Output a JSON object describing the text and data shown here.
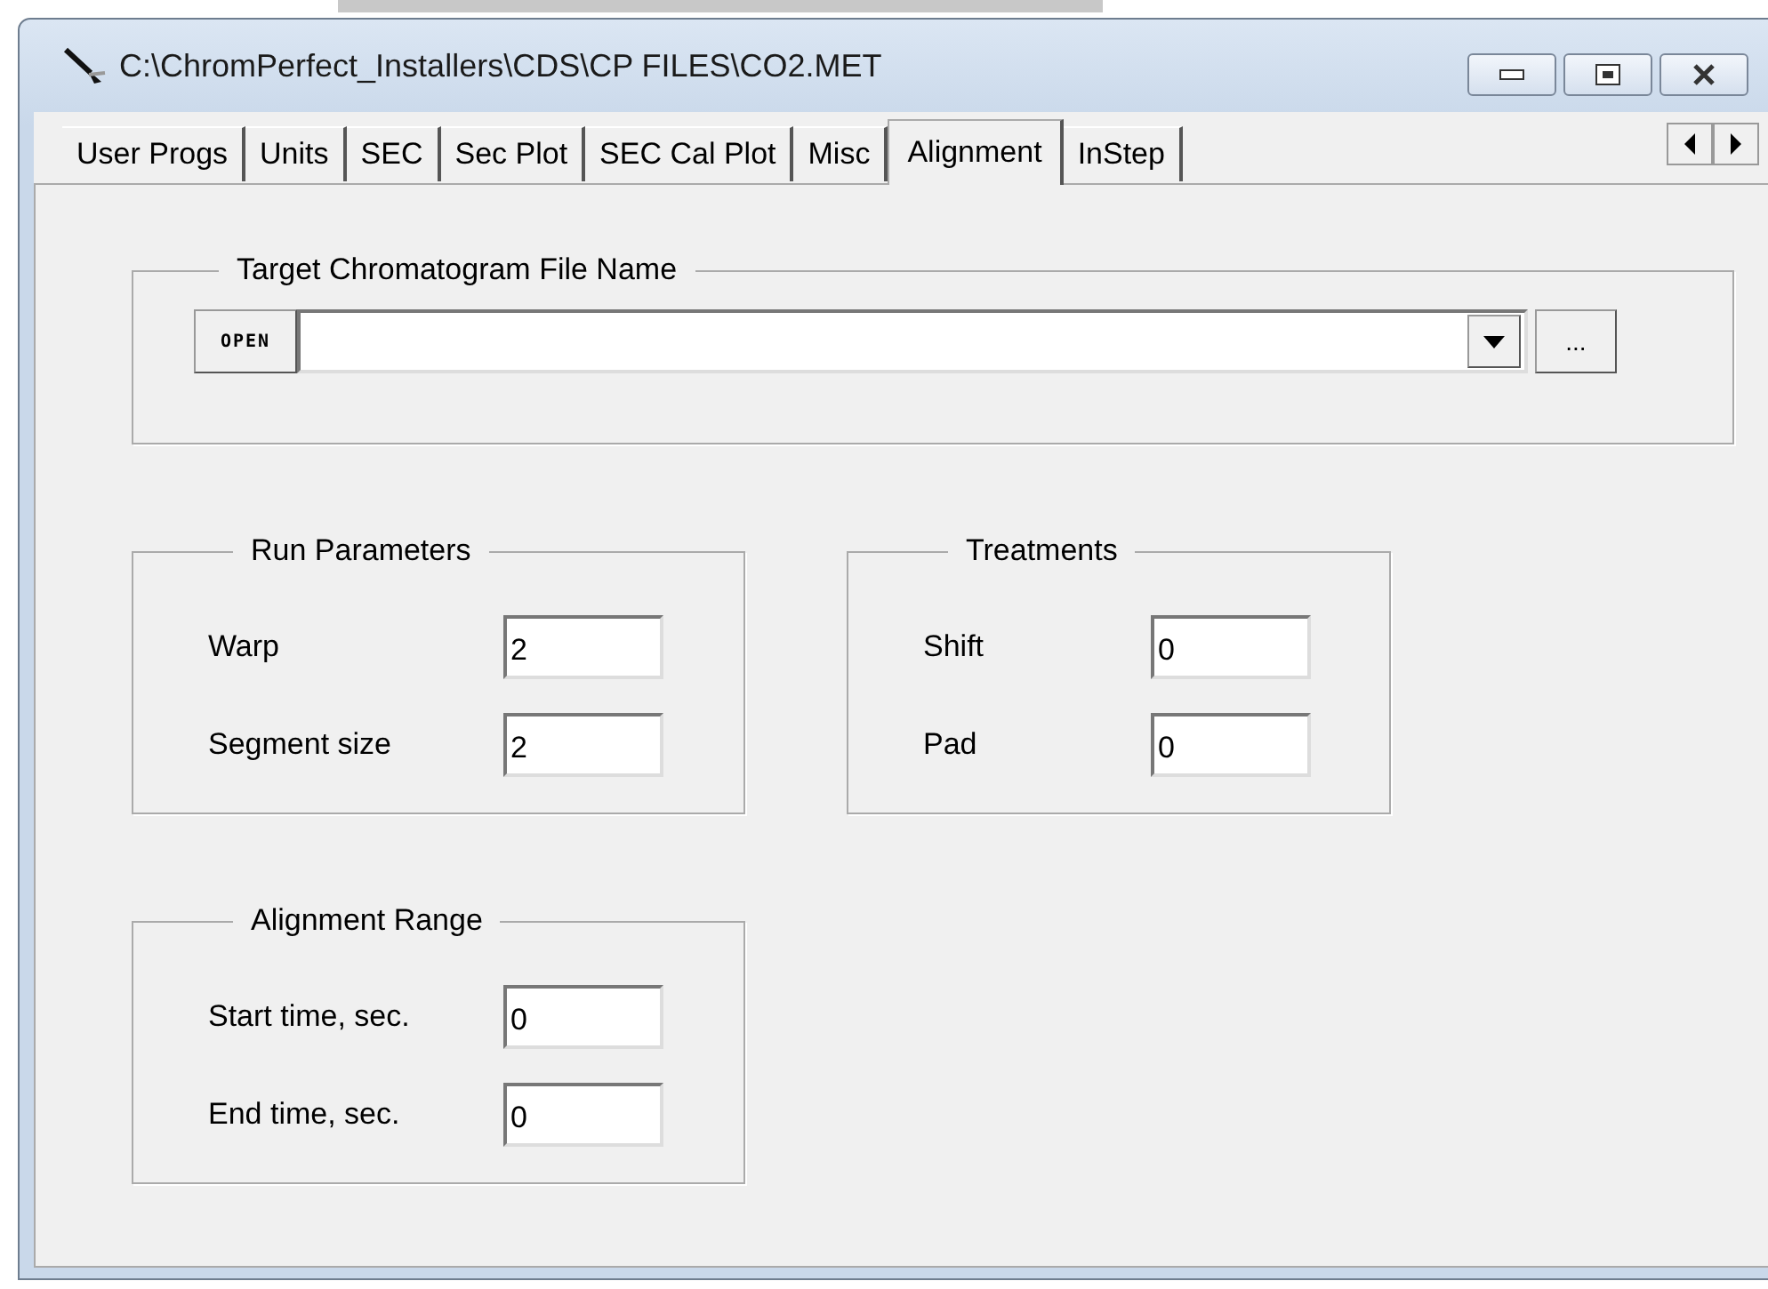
{
  "window": {
    "title": "C:\\ChromPerfect_Installers\\CDS\\CP FILES\\CO2.MET"
  },
  "tabs": [
    {
      "label": "User Progs",
      "selected": false
    },
    {
      "label": "Units",
      "selected": false
    },
    {
      "label": "SEC",
      "selected": false
    },
    {
      "label": "Sec Plot",
      "selected": false
    },
    {
      "label": "SEC Cal Plot",
      "selected": false
    },
    {
      "label": "Misc",
      "selected": false
    },
    {
      "label": "Alignment",
      "selected": true
    },
    {
      "label": "InStep",
      "selected": false
    }
  ],
  "target_group": {
    "legend": "Target Chromatogram File Name",
    "open_button": "OPEN",
    "browse_button": "..."
  },
  "groups": [
    {
      "legend": "Run Parameters",
      "fields": [
        {
          "label": "Warp",
          "value": "2"
        },
        {
          "label": "Segment size",
          "value": "2"
        }
      ]
    },
    {
      "legend": "Treatments",
      "fields": [
        {
          "label": "Shift",
          "value": "0"
        },
        {
          "label": "Pad",
          "value": "0"
        }
      ]
    },
    {
      "legend": "Alignment Range",
      "fields": [
        {
          "label": "Start time, sec.",
          "value": "0"
        },
        {
          "label": "End time, sec.",
          "value": "0"
        }
      ]
    }
  ]
}
